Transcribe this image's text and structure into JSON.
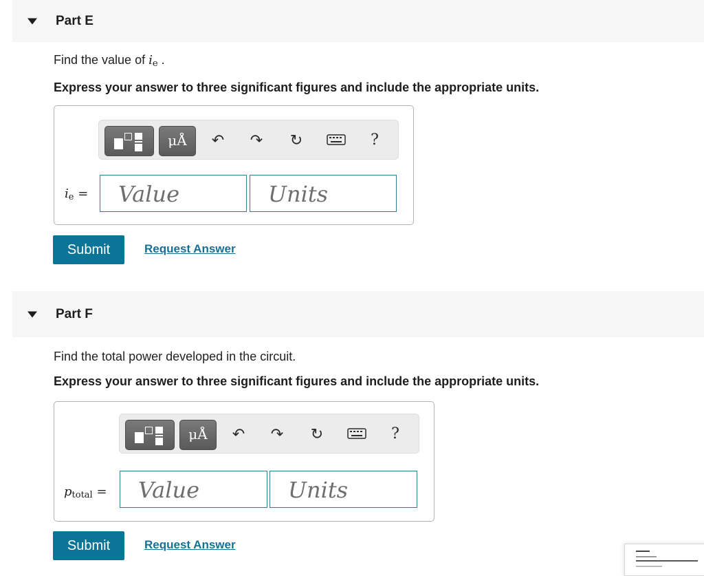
{
  "partE": {
    "title": "Part E",
    "prompt_pre": "Find the value of ",
    "prompt_var": "i",
    "prompt_sub": "e",
    "prompt_post": " .",
    "instruction": "Express your answer to three significant figures and include the appropriate units.",
    "label_var": "i",
    "label_sub": "e",
    "label_eq": " =",
    "value_placeholder": "Value",
    "units_placeholder": "Units",
    "units_btn": "μÅ",
    "help": "?",
    "submit": "Submit",
    "request": "Request Answer"
  },
  "partF": {
    "title": "Part F",
    "prompt": "Find the total power developed in the circuit.",
    "instruction": "Express your answer to three significant figures and include the appropriate units.",
    "label_var": "p",
    "label_sub": "total",
    "label_eq": " =",
    "value_placeholder": "Value",
    "units_placeholder": "Units",
    "units_btn": "μÅ",
    "help": "?",
    "submit": "Submit",
    "request": "Request Answer"
  },
  "icons": [
    "templates-icon",
    "units-icon",
    "undo-icon",
    "redo-icon",
    "reset-icon",
    "keyboard-icon",
    "help-icon"
  ],
  "colors": {
    "submit_bg": "#0a7596",
    "link": "#1a6f97",
    "field_border": "#2e7d97"
  }
}
